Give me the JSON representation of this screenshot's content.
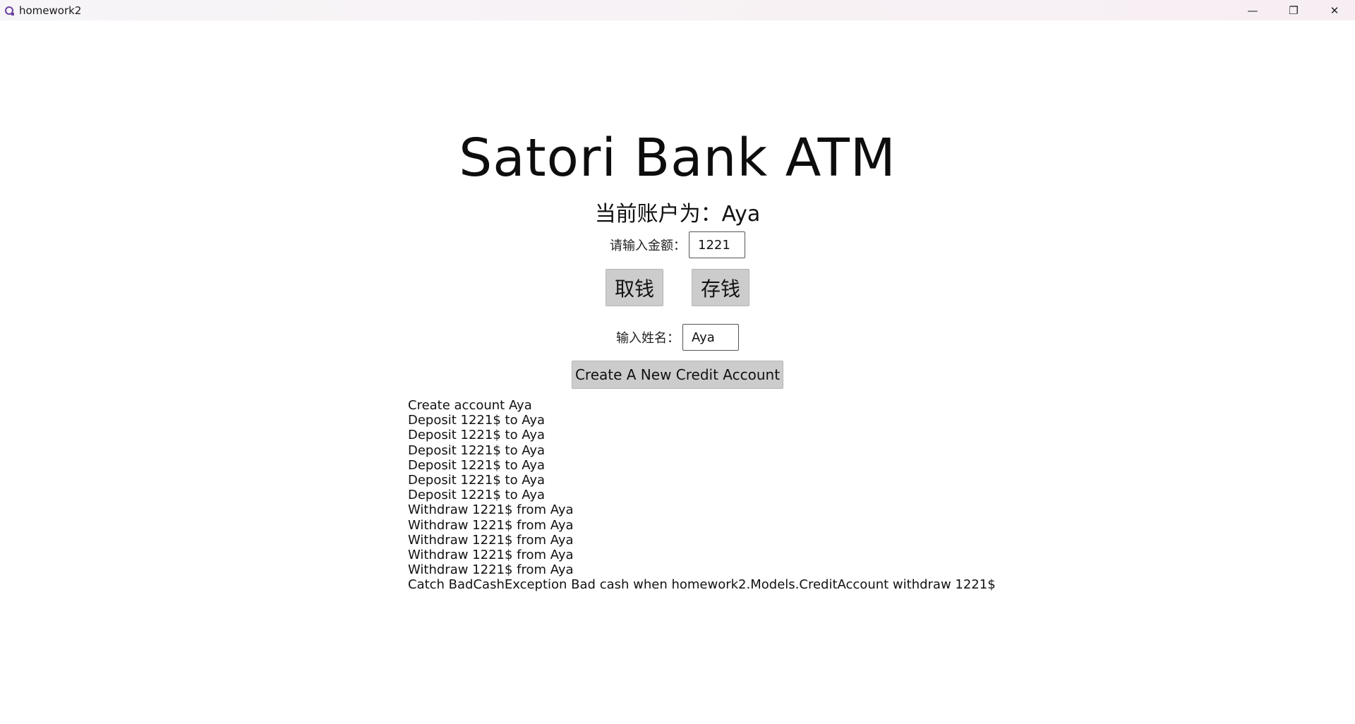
{
  "window": {
    "title": "homework2",
    "minimize_glyph": "—",
    "maximize_glyph": "❐",
    "close_glyph": "✕"
  },
  "main": {
    "heading": "Satori Bank ATM",
    "current_account": "当前账户为：Aya",
    "amount_label": "请输入金额：",
    "amount_value": "1221",
    "withdraw_label": "取钱",
    "deposit_label": "存钱",
    "name_label": "输入姓名：",
    "name_value": "Aya",
    "create_label": "Create A New Credit Account"
  },
  "log": [
    "Create account Aya",
    "Deposit 1221$ to Aya",
    "Deposit 1221$ to Aya",
    "Deposit 1221$ to Aya",
    "Deposit 1221$ to Aya",
    "Deposit 1221$ to Aya",
    "Deposit 1221$ to Aya",
    "Withdraw 1221$ from Aya",
    "Withdraw 1221$ from Aya",
    "Withdraw 1221$ from Aya",
    "Withdraw 1221$ from Aya",
    "Withdraw 1221$ from Aya",
    "Catch BadCashException Bad cash when homework2.Models.CreditAccount withdraw 1221$"
  ],
  "icons": {
    "app": "app-icon",
    "minimize": "minimize-icon",
    "maximize": "restore-icon",
    "close": "close-icon"
  }
}
